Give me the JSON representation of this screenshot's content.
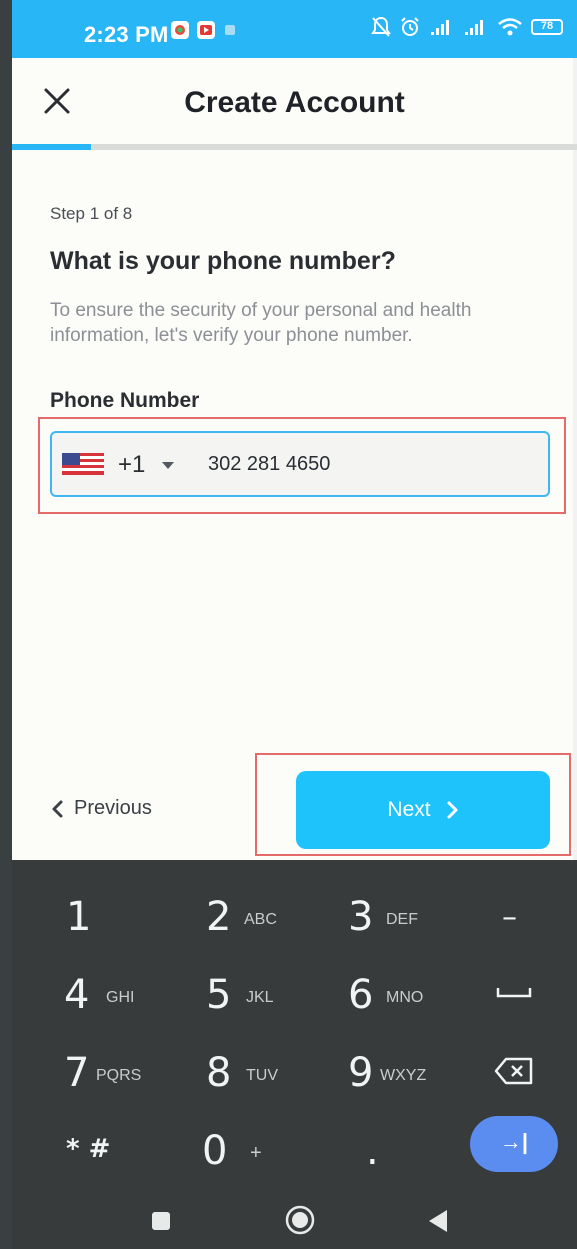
{
  "status_bar": {
    "time": "2:23 PM",
    "battery": "78",
    "accent": "#29b6f6"
  },
  "header": {
    "title": "Create Account",
    "close_icon": "close-icon"
  },
  "progress": {
    "current_step": 1,
    "total_steps": 8,
    "fill_fraction": 0.14
  },
  "content": {
    "step_label": "Step 1 of 8",
    "question": "What is your phone number?",
    "description": "To ensure the security of your personal and health information, let's verify your phone number.",
    "field_label": "Phone Number",
    "country_code": "+1",
    "country_flag": "us-flag-icon",
    "phone_value": "302 281 4650"
  },
  "footer": {
    "previous_label": "Previous",
    "next_label": "Next",
    "next_color": "#1ec3fb"
  },
  "keyboard": {
    "keys": [
      {
        "main": "1",
        "sub": ""
      },
      {
        "main": "2",
        "sub": "ABC"
      },
      {
        "main": "3",
        "sub": "DEF"
      },
      {
        "main": "–",
        "sub": ""
      },
      {
        "main": "4",
        "sub": "GHI"
      },
      {
        "main": "5",
        "sub": "JKL"
      },
      {
        "main": "6",
        "sub": "MNO"
      },
      {
        "main": "␣",
        "sub": ""
      },
      {
        "main": "7",
        "sub": "PQRS"
      },
      {
        "main": "8",
        "sub": "TUV"
      },
      {
        "main": "9",
        "sub": "WXYZ"
      },
      {
        "main": "⌫",
        "sub": ""
      },
      {
        "main": "* #",
        "sub": ""
      },
      {
        "main": "0",
        "sub": "+"
      },
      {
        "main": ".",
        "sub": ""
      },
      {
        "main": "→|",
        "sub": ""
      }
    ]
  }
}
